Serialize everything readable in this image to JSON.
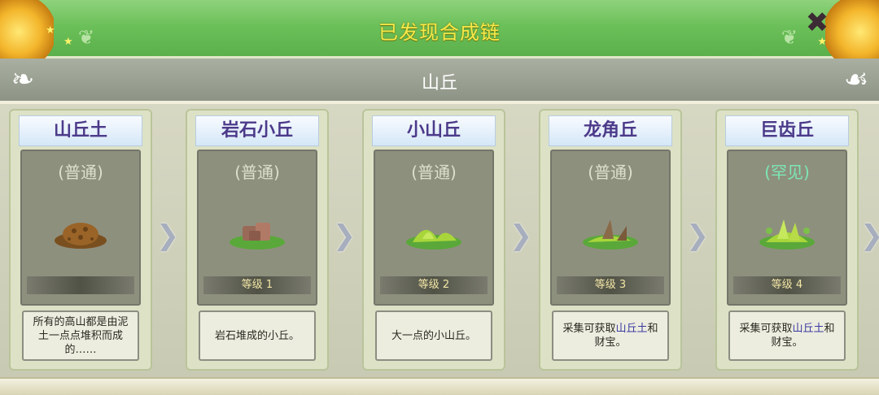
{
  "header": {
    "title": "已发现合成链",
    "close_symbol": "✖"
  },
  "subheader": {
    "title": "山丘"
  },
  "cards": [
    {
      "name": "山丘土",
      "rarity": "(普通)",
      "rarity_type": "common",
      "level": "",
      "desc": "所有的高山都是由泥土一点点堆积而成的……",
      "icon": "dirt-pile-icon"
    },
    {
      "name": "岩石小丘",
      "rarity": "(普通)",
      "rarity_type": "common",
      "level": "等级 1",
      "desc": "岩石堆成的小丘。",
      "icon": "rocky-hill-icon"
    },
    {
      "name": "小山丘",
      "rarity": "(普通)",
      "rarity_type": "common",
      "level": "等级 2",
      "desc": "大一点的小山丘。",
      "icon": "small-hill-icon"
    },
    {
      "name": "龙角丘",
      "rarity": "(普通)",
      "rarity_type": "common",
      "level": "等级 3",
      "desc_parts": [
        "采集可获取",
        "山丘土",
        "和财宝。"
      ],
      "icon": "dragon-horn-hill-icon"
    },
    {
      "name": "巨齿丘",
      "rarity": "(罕见)",
      "rarity_type": "rare",
      "level": "等级 4",
      "desc_parts": [
        "采集可获取",
        "山丘土",
        "和财宝。"
      ],
      "icon": "giant-tooth-hill-icon"
    }
  ],
  "arrow_symbol": "❯",
  "colors": {
    "header_green": "#6cc05a",
    "title_yellow": "#f6e94a",
    "rare_green": "#7ce8b5",
    "highlight_blue": "#3a3aa0"
  }
}
